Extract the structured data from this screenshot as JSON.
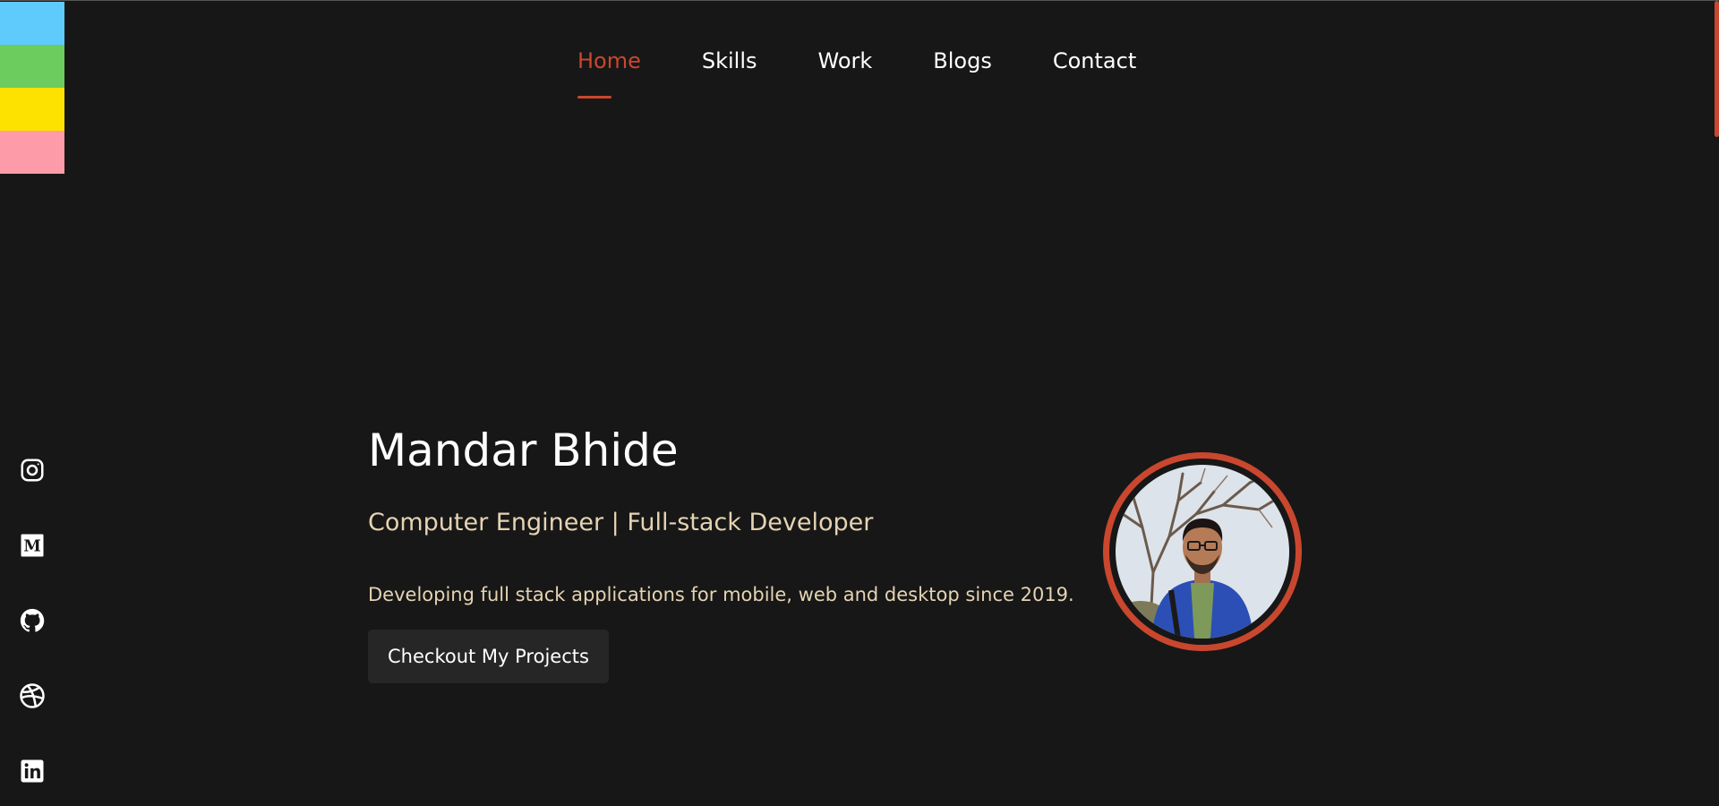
{
  "swatches": [
    {
      "name": "blue",
      "color": "#5ecbfc"
    },
    {
      "name": "green",
      "color": "#6ccc5e"
    },
    {
      "name": "yellow",
      "color": "#fde200"
    },
    {
      "name": "pink",
      "color": "#fd9ca8"
    }
  ],
  "nav": {
    "items": [
      {
        "label": "Home",
        "active": true
      },
      {
        "label": "Skills",
        "active": false
      },
      {
        "label": "Work",
        "active": false
      },
      {
        "label": "Blogs",
        "active": false
      },
      {
        "label": "Contact",
        "active": false
      }
    ]
  },
  "socials": [
    {
      "icon": "instagram-icon"
    },
    {
      "icon": "medium-icon"
    },
    {
      "icon": "github-icon"
    },
    {
      "icon": "dribbble-icon"
    },
    {
      "icon": "linkedin-icon"
    }
  ],
  "hero": {
    "name": "Mandar Bhide",
    "role": "Computer Engineer | Full-stack Developer",
    "description": "Developing full stack applications for mobile, web and desktop since 2019.",
    "cta_label": "Checkout My Projects"
  },
  "colors": {
    "accent": "#c9472e",
    "background": "#171717",
    "muted_text": "#e5d3b3",
    "button_bg": "#262626"
  }
}
